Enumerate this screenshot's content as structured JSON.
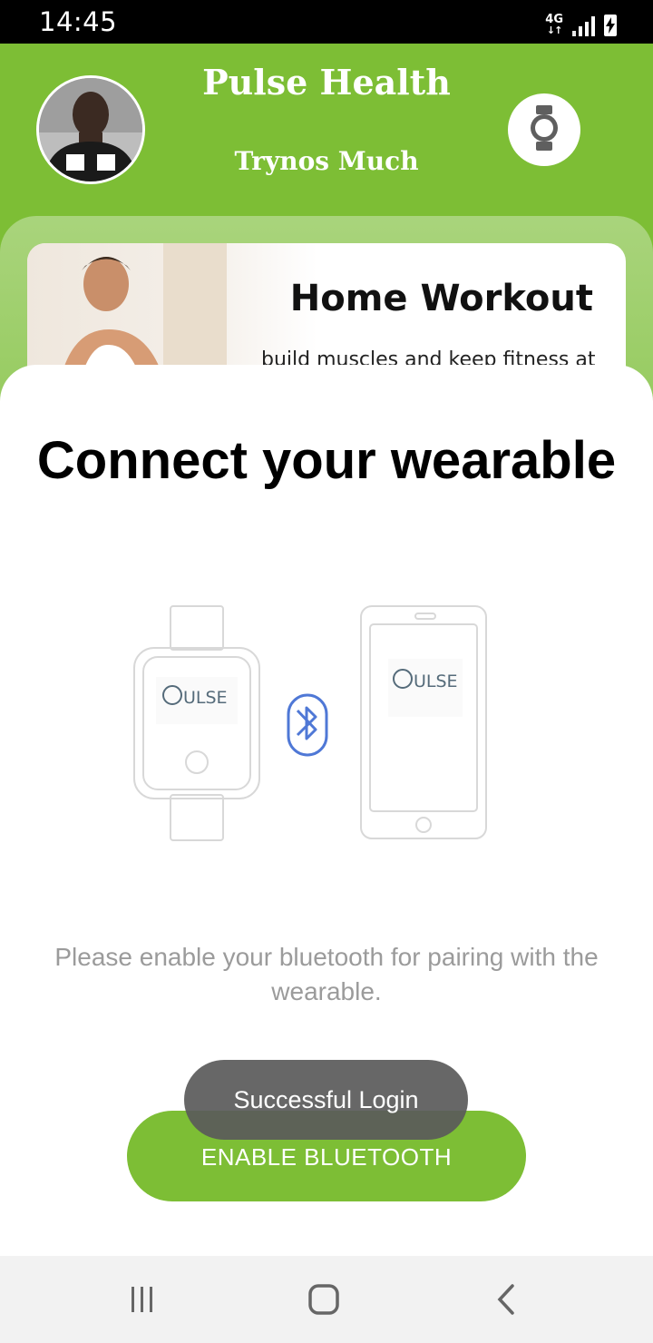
{
  "status_bar": {
    "time": "14:45",
    "network": "4G",
    "network_arrows": "↓↑",
    "icons": [
      "signal-icon",
      "battery-charging-icon"
    ]
  },
  "header": {
    "app_title": "Pulse Health",
    "user_name": "Trynos Much",
    "watch_icon": "watch-icon",
    "accent_color": "#7dbe35"
  },
  "workout_card": {
    "title": "Home Workout",
    "subtitle": "build muscles and keep fitness at"
  },
  "sheet": {
    "title": "Connect your wearable",
    "watch_logo": "ULSE",
    "phone_logo": "ULSE",
    "message": "Please enable your bluetooth for pairing with the wearable.",
    "button_label": "ENABLE BLUETOOTH"
  },
  "toast": {
    "text": "Successful Login"
  },
  "nav_bar": {
    "icons": [
      "recent-apps-icon",
      "home-icon",
      "back-icon"
    ]
  }
}
